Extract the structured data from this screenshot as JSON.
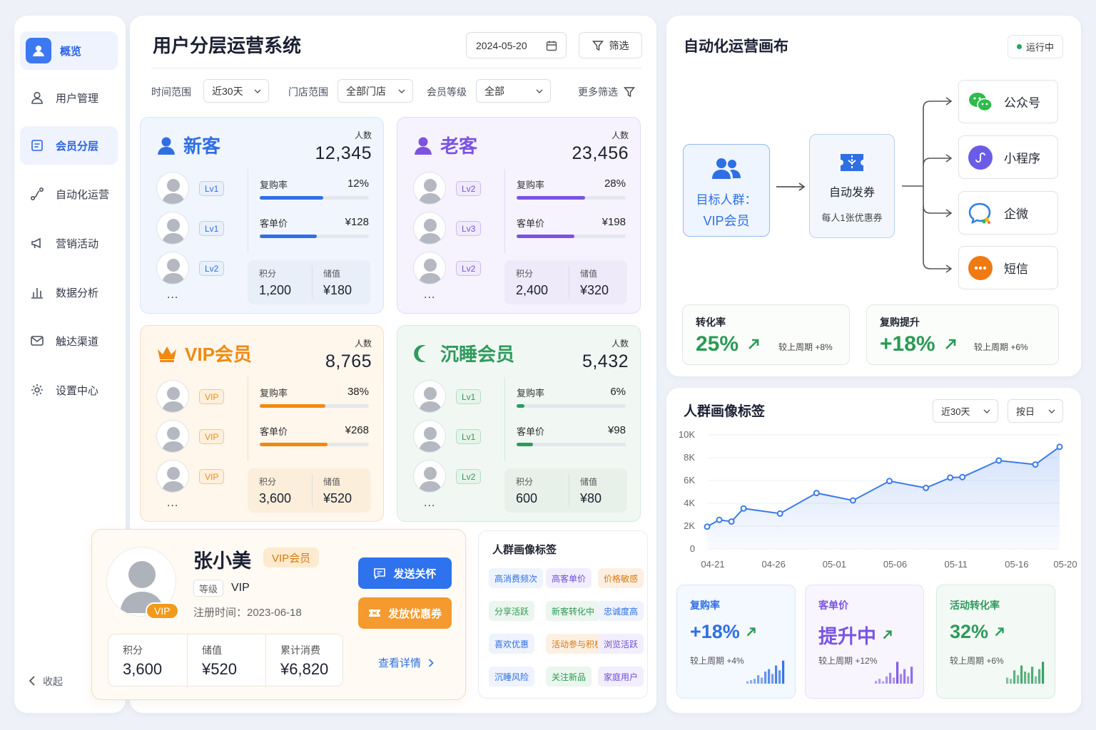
{
  "sidebar": {
    "items": [
      {
        "label": "概览",
        "icon": "user-icon"
      },
      {
        "label": "用户管理",
        "icon": "person-icon"
      },
      {
        "label": "会员分层",
        "icon": "layers-icon"
      },
      {
        "label": "自动化运营",
        "icon": "flow-icon"
      },
      {
        "label": "营销活动",
        "icon": "megaphone-icon"
      },
      {
        "label": "数据分析",
        "icon": "bar-chart-icon"
      },
      {
        "label": "触达渠道",
        "icon": "mail-icon"
      },
      {
        "label": "设置中心",
        "icon": "gear-icon"
      }
    ],
    "collapse_label": "收起"
  },
  "header": {
    "title": "用户分层运营系统",
    "date": "2024-05-20",
    "filter_label": "筛选"
  },
  "filters": {
    "time_label": "时间范围",
    "time_value": "近30天",
    "store_label": "门店范围",
    "store_value": "全部门店",
    "level_label": "会员等级",
    "level_value": "全部",
    "more_label": "更多筛选"
  },
  "segments": [
    {
      "name": "新客",
      "count_label": "人数",
      "count": "12,345",
      "levels": [
        "Lv1",
        "Lv1",
        "Lv2"
      ],
      "more": "...",
      "repurchase_label": "复购率",
      "repurchase": "12%",
      "repurchase_fill": 0.58,
      "aov_label": "客单价",
      "aov": "¥128",
      "aov_fill": 0.52,
      "points_label": "积分",
      "points": "1,200",
      "stored_label": "储值",
      "stored": "¥180",
      "color": "#2f6fe4"
    },
    {
      "name": "老客",
      "count_label": "人数",
      "count": "23,456",
      "levels": [
        "Lv2",
        "Lv3",
        "Lv2"
      ],
      "more": "...",
      "repurchase_label": "复购率",
      "repurchase": "28%",
      "repurchase_fill": 0.63,
      "aov_label": "客单价",
      "aov": "¥198",
      "aov_fill": 0.53,
      "points_label": "积分",
      "points": "2,400",
      "stored_label": "储值",
      "stored": "¥320",
      "color": "#7b53e0"
    },
    {
      "name": "VIP会员",
      "count_label": "人数",
      "count": "8,765",
      "levels": [
        "VIP",
        "VIP",
        "VIP"
      ],
      "more": "...",
      "repurchase_label": "复购率",
      "repurchase": "38%",
      "repurchase_fill": 0.6,
      "aov_label": "客单价",
      "aov": "¥268",
      "aov_fill": 0.62,
      "points_label": "积分",
      "points": "3,600",
      "stored_label": "储值",
      "stored": "¥520",
      "color": "#f08a10"
    },
    {
      "name": "沉睡会员",
      "count_label": "人数",
      "count": "5,432",
      "levels": [
        "Lv1",
        "Lv1",
        "Lv2"
      ],
      "more": "...",
      "repurchase_label": "复购率",
      "repurchase": "6%",
      "repurchase_fill": 0.07,
      "aov_label": "客单价",
      "aov": "¥98",
      "aov_fill": 0.15,
      "points_label": "积分",
      "points": "600",
      "stored_label": "储值",
      "stored": "¥80",
      "color": "#2f9a5d"
    }
  ],
  "user_card": {
    "name": "张小美",
    "badge": "VIP会员",
    "avatar_badge": "VIP",
    "level_label": "等级",
    "level": "VIP",
    "register": "注册时间：2023-06-18",
    "points_label": "积分",
    "points": "3,600",
    "stored_label": "储值",
    "stored": "¥520",
    "total_label": "累计消费",
    "total": "¥6,820",
    "care_button": "发送关怀",
    "coupon_button": "发放优惠券",
    "detail_link": "查看详情"
  },
  "tag_card": {
    "title": "人群画像标签",
    "tags": [
      "高消费频次",
      "高客单价",
      "价格敏感",
      "分享活跃",
      "新客转化中",
      "忠诚度高",
      "喜欢优惠",
      "活动参与积极",
      "浏览活跃",
      "沉睡风险",
      "关注新品",
      "家庭用户"
    ]
  },
  "automation": {
    "title": "自动化运营画布",
    "status": "运行中",
    "target_line1": "目标人群：",
    "target_line2": "VIP会员",
    "trigger_title": "自动发券",
    "trigger_desc": "每人1张优惠券",
    "channels": [
      {
        "label": "公众号",
        "icon": "wechat-icon",
        "color": "#2dbb4e"
      },
      {
        "label": "小程序",
        "icon": "miniprogram-icon",
        "color": "#6b5ce7"
      },
      {
        "label": "企微",
        "icon": "wecom-icon",
        "color": "#2f7de6"
      },
      {
        "label": "短信",
        "icon": "sms-icon",
        "color": "#f07a12"
      }
    ],
    "kpis": [
      {
        "label": "转化率",
        "value": "25%",
        "compare": "较上周期 +8%"
      },
      {
        "label": "复购提升",
        "value": "+18%",
        "compare": "较上周期 +6%"
      }
    ]
  },
  "portrait": {
    "title": "人群画像标签",
    "range": "近30天",
    "granularity": "按日",
    "mini_cards": [
      {
        "title": "复购率",
        "value": "+18%",
        "compare": "较上周期 +4%",
        "color": "#2f6fe4",
        "bars": [
          0.1,
          0.15,
          0.2,
          0.35,
          0.25,
          0.5,
          0.6,
          0.4,
          0.75,
          0.55,
          0.95
        ]
      },
      {
        "title": "客单价",
        "value": "提升中",
        "compare": "较上周期 +12%",
        "color": "#7b53e0",
        "bars": [
          0.12,
          0.2,
          0.1,
          0.3,
          0.45,
          0.25,
          0.9,
          0.4,
          0.6,
          0.3,
          0.7
        ]
      },
      {
        "title": "活动转化率",
        "value": "32%",
        "compare": "较上周期 +6%",
        "color": "#2f9a5d",
        "bars": [
          0.25,
          0.2,
          0.55,
          0.35,
          0.75,
          0.5,
          0.45,
          0.7,
          0.3,
          0.6,
          0.9
        ]
      }
    ]
  },
  "chart_data": {
    "type": "area",
    "title": "人群画像标签",
    "xlabel": "",
    "ylabel": "",
    "x_ticks": [
      "04-21",
      "04-26",
      "05-01",
      "05-06",
      "05-11",
      "05-16",
      "05-20"
    ],
    "y_ticks": [
      "0",
      "2K",
      "4K",
      "6K",
      "8K",
      "10K"
    ],
    "ylim": [
      0,
      10000
    ],
    "x": [
      "04-21",
      "04-22",
      "04-23",
      "04-24",
      "04-27",
      "04-30",
      "05-03",
      "05-06",
      "05-09",
      "05-11",
      "05-12",
      "05-15",
      "05-18",
      "05-20"
    ],
    "values": [
      1950,
      2550,
      2400,
      3550,
      3100,
      4900,
      4250,
      5950,
      5350,
      6250,
      6300,
      7750,
      7400,
      8950
    ],
    "grid": true,
    "color": "#3b7bea"
  }
}
